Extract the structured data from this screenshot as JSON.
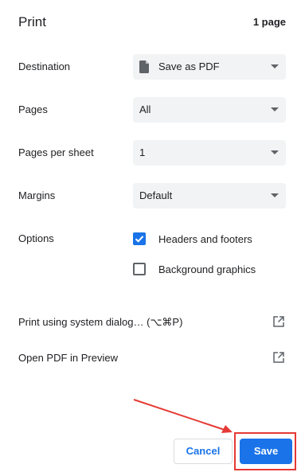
{
  "header": {
    "title": "Print",
    "page_count": "1 page"
  },
  "settings": {
    "destination": {
      "label": "Destination",
      "value": "Save as PDF",
      "icon": "document-icon"
    },
    "pages": {
      "label": "Pages",
      "value": "All"
    },
    "pages_per_sheet": {
      "label": "Pages per sheet",
      "value": "1"
    },
    "margins": {
      "label": "Margins",
      "value": "Default"
    },
    "options": {
      "label": "Options",
      "headers_footers": {
        "label": "Headers and footers",
        "checked": true
      },
      "background_graphics": {
        "label": "Background graphics",
        "checked": false
      }
    }
  },
  "links": {
    "system_dialog": {
      "label": "Print using system dialog… (⌥⌘P)",
      "icon": "open-external-icon"
    },
    "open_preview": {
      "label": "Open PDF in Preview",
      "icon": "open-external-icon"
    }
  },
  "footer": {
    "cancel_label": "Cancel",
    "save_label": "Save"
  },
  "colors": {
    "accent": "#1a73e8",
    "select_bg": "#f1f3f4",
    "annotation": "#e53935"
  }
}
